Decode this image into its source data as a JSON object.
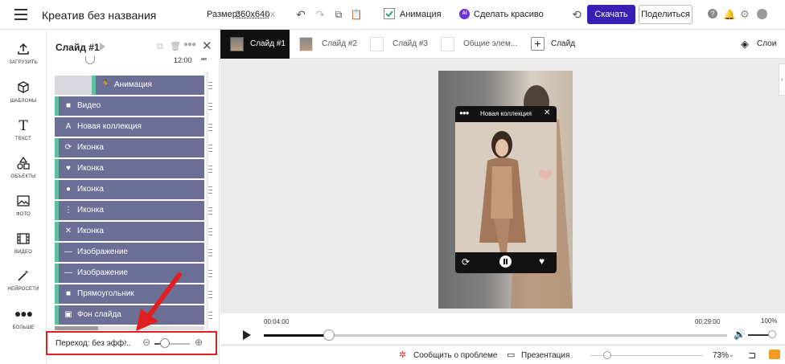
{
  "app": {
    "title": "Креатив без названия",
    "size_label": "Размер:",
    "size_value": "360x640",
    "size_unit": "px",
    "animation_label": "Анимация",
    "animation_checked": true,
    "ai_label": "Сделать красиво",
    "ai_badge": "AI",
    "download_label": "Скачать",
    "share_label": "Поделиться",
    "accent_color": "#3a1fb5"
  },
  "nav": [
    {
      "label": "ЗАГРУЗИТЬ",
      "icon": "upload-icon"
    },
    {
      "label": "ШАБЛОНЫ",
      "icon": "templates-icon"
    },
    {
      "label": "ТЕКСТ",
      "icon": "text-icon"
    },
    {
      "label": "ОБЪЕКТЫ",
      "icon": "objects-icon"
    },
    {
      "label": "ФОТО",
      "icon": "photo-icon"
    },
    {
      "label": "ВИДЕО",
      "icon": "video-icon"
    },
    {
      "label": "НЕЙРОСЕТИ",
      "icon": "magic-wand-icon"
    },
    {
      "label": "БОЛЬШЕ",
      "icon": "more-icon"
    }
  ],
  "panel": {
    "title": "Слайд #1",
    "scroll_time": "12:00",
    "layers": [
      {
        "label": "Анимация",
        "icon": "run-icon",
        "bar": true,
        "indent": true
      },
      {
        "label": "Видео",
        "icon": "video-icon",
        "bar": true
      },
      {
        "label": "Новая коллекция",
        "icon": "text-A-icon",
        "bar": false
      },
      {
        "label": "Иконка",
        "icon": "sync-icon",
        "bar": true
      },
      {
        "label": "Иконка",
        "icon": "heart-icon",
        "bar": true
      },
      {
        "label": "Иконка",
        "icon": "pause-circle-icon",
        "bar": true
      },
      {
        "label": "Иконка",
        "icon": "dots-vertical-icon",
        "bar": true
      },
      {
        "label": "Иконка",
        "icon": "close-icon",
        "bar": true
      },
      {
        "label": "Изображение",
        "icon": "line-icon",
        "bar": true
      },
      {
        "label": "Изображение",
        "icon": "line-icon",
        "bar": true
      },
      {
        "label": "Прямоугольник",
        "icon": "square-icon",
        "bar": true
      },
      {
        "label": "Фон слайда",
        "icon": "background-icon",
        "bar": true
      }
    ],
    "transition_label": "Переход: без эфф...",
    "transition_zoom": 0.3
  },
  "tabs": [
    {
      "label": "Слайд #1",
      "active": true
    },
    {
      "label": "Слайд #2",
      "active": false
    },
    {
      "label": "Слайд #3",
      "active": false
    },
    {
      "label": "Общие элем...",
      "active": false
    }
  ],
  "add_slide_label": "Слайд",
  "layers_label": "Слои",
  "widget": {
    "title": "Новая коллекция"
  },
  "timeline": {
    "current_time": "00:04:00",
    "end_time": "00:29:00",
    "progress": 0.14,
    "volume_label": "100%",
    "volume": 1.0
  },
  "statusbar": {
    "report_label": "Сообщить о проблеме",
    "presentation_label": "Презентация",
    "zoom_label": "73%",
    "zoom": 0.15
  }
}
